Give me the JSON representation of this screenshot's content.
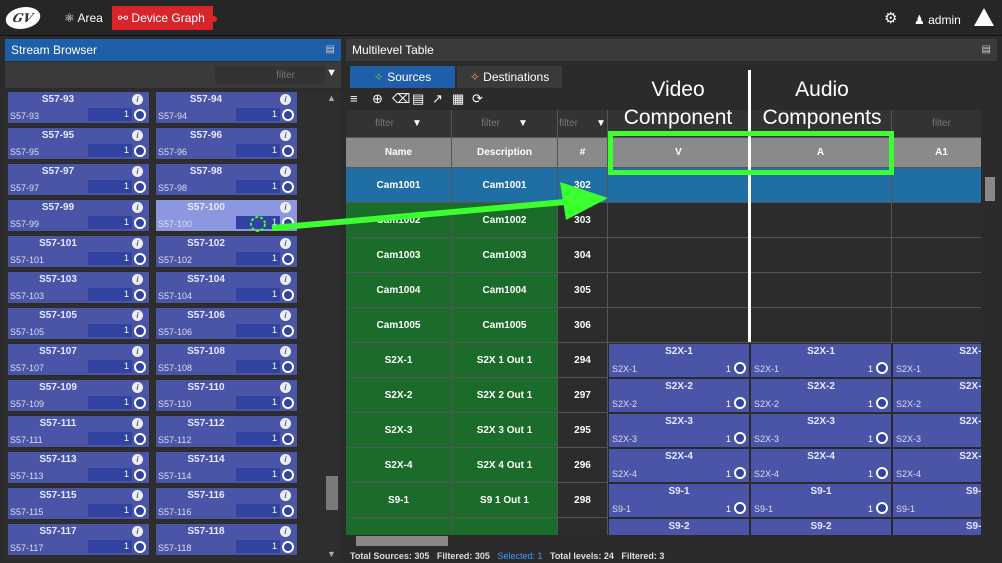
{
  "topbar": {
    "area_label": "Area",
    "device_graph_label": "Device Graph",
    "user_label": "admin"
  },
  "stream_browser": {
    "title": "Stream Browser",
    "filter_placeholder": "filter",
    "tiles": [
      [
        "S57-93",
        "S57-94"
      ],
      [
        "S57-95",
        "S57-96"
      ],
      [
        "S57-97",
        "S57-98"
      ],
      [
        "S57-99",
        "S57-100"
      ],
      [
        "S57-101",
        "S57-102"
      ],
      [
        "S57-103",
        "S57-104"
      ],
      [
        "S57-105",
        "S57-106"
      ],
      [
        "S57-107",
        "S57-108"
      ],
      [
        "S57-109",
        "S57-110"
      ],
      [
        "S57-111",
        "S57-112"
      ],
      [
        "S57-113",
        "S57-114"
      ],
      [
        "S57-115",
        "S57-116"
      ],
      [
        "S57-117",
        "S57-118"
      ]
    ],
    "tile_value": "1",
    "selected": "S57-100"
  },
  "multilevel_table": {
    "title": "Multilevel Table",
    "tab_sources": "Sources",
    "tab_destinations": "Destinations",
    "filters": [
      "filter",
      "filter",
      "filter",
      "",
      "",
      "filter"
    ],
    "headers": [
      "Name",
      "Description",
      "#",
      "V",
      "A",
      "A1"
    ],
    "rows": [
      {
        "name": "Cam1001",
        "desc": "Cam1001",
        "num": "302"
      },
      {
        "name": "Cam1002",
        "desc": "Cam1002",
        "num": "303"
      },
      {
        "name": "Cam1003",
        "desc": "Cam1003",
        "num": "304"
      },
      {
        "name": "Cam1004",
        "desc": "Cam1004",
        "num": "305"
      },
      {
        "name": "Cam1005",
        "desc": "Cam1005",
        "num": "306"
      },
      {
        "name": "S2X-1",
        "desc": "S2X 1 Out 1",
        "num": "294",
        "stream": "S2X-1"
      },
      {
        "name": "S2X-2",
        "desc": "S2X 2 Out 1",
        "num": "297",
        "stream": "S2X-2"
      },
      {
        "name": "S2X-3",
        "desc": "S2X 3 Out 1",
        "num": "295",
        "stream": "S2X-3"
      },
      {
        "name": "S2X-4",
        "desc": "S2X 4 Out 1",
        "num": "296",
        "stream": "S2X-4"
      },
      {
        "name": "S9-1",
        "desc": "S9 1 Out 1",
        "num": "298",
        "stream": "S9-1"
      },
      {
        "name": "",
        "desc": "",
        "num": "",
        "stream": "S9-2"
      }
    ],
    "status": {
      "total": "Total Sources: 305",
      "filtered": "Filtered: 305",
      "selected": "Selected: 1",
      "levels": "Total levels: 24",
      "levels_filtered": "Filtered: 3"
    }
  },
  "annotations": {
    "video_1": "Video",
    "video_2": "Component",
    "audio_1": "Audio",
    "audio_2": "Components"
  },
  "colors": {
    "highlight": "#3bff2f",
    "brand_red": "#d8252b",
    "tile_blue": "#4a55a7",
    "selected_row": "#1f6fa5"
  }
}
